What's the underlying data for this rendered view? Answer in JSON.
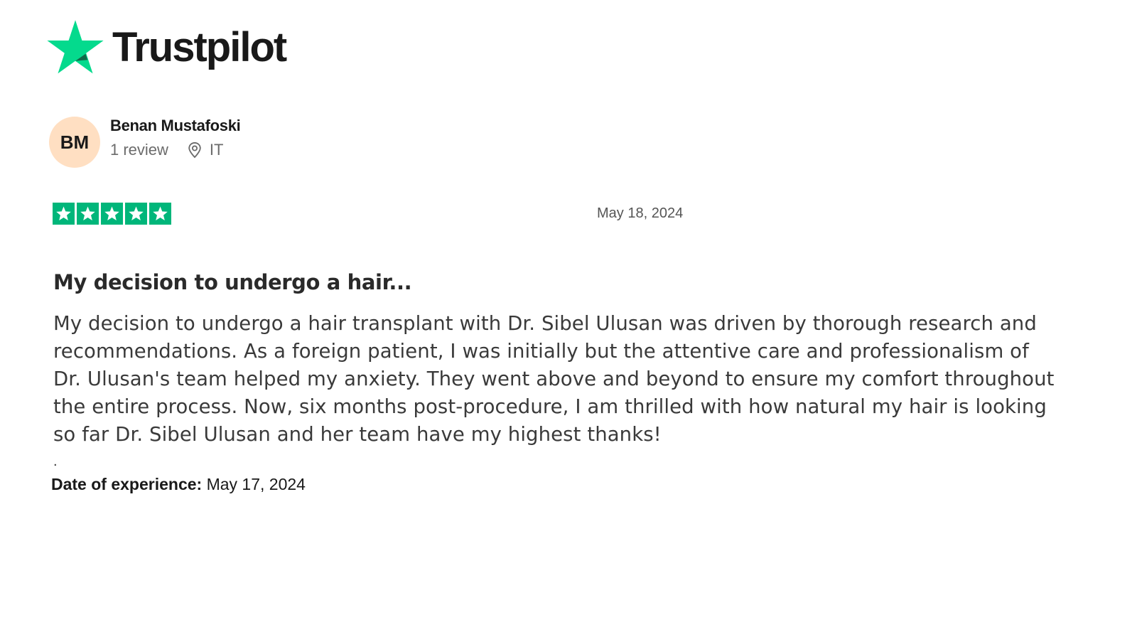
{
  "brand": {
    "name": "Trustpilot",
    "star_color": "#00b67a",
    "logo_star_color": "#04da8d"
  },
  "reviewer": {
    "initials": "BM",
    "name": "Benan Mustafoski",
    "review_count": "1 review",
    "country": "IT",
    "avatar_color": "#ffdfc2",
    "location_icon": "location-pin-icon"
  },
  "review": {
    "rating": 5,
    "rating_max": 5,
    "date": "May 18, 2024",
    "title": "My decision to undergo a hair...",
    "body": "My decision to undergo a hair transplant with Dr. Sibel Ulusan was driven by thorough research and recommendations. As a foreign patient, I was initially but the attentive care and professionalism of Dr. Ulusan's team helped my anxiety. They went above and beyond to ensure my comfort throughout the entire process. Now, six months post-procedure, I am thrilled with how natural my hair is looking so far Dr. Sibel Ulusan and her team have my highest thanks!",
    "trailing_mark": ".",
    "experience_label": "Date of experience:",
    "experience_date": "May 17, 2024"
  }
}
